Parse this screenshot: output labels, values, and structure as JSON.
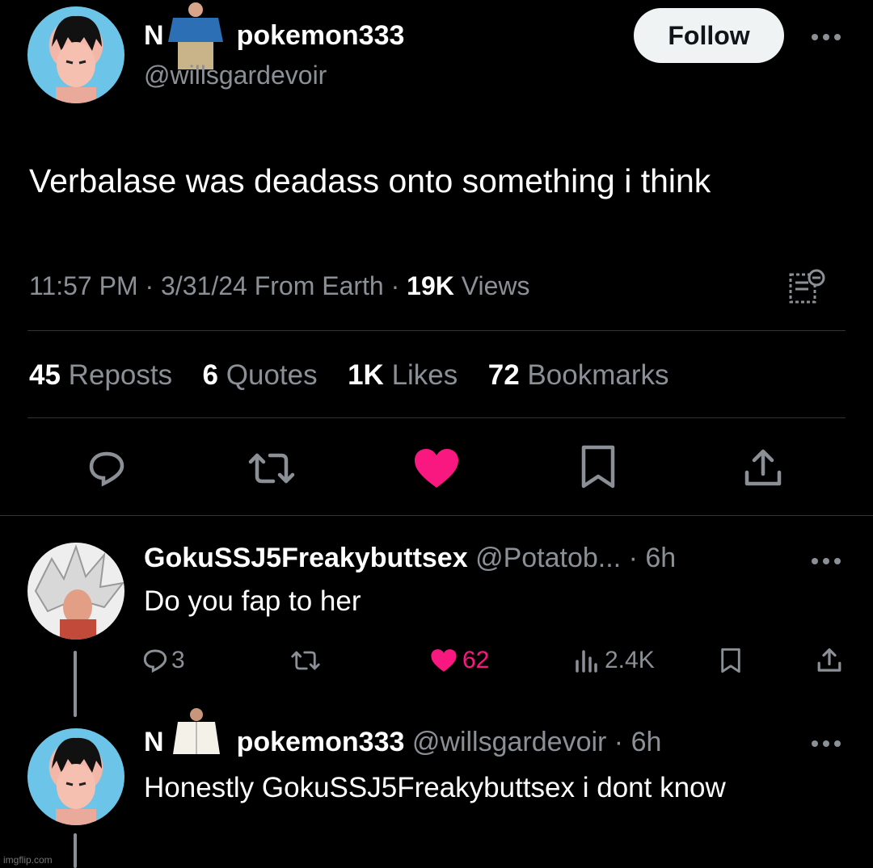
{
  "post": {
    "display_name_prefix": "N",
    "display_name_suffix": "pokemon333",
    "handle": "@willsgardevoir",
    "follow_label": "Follow",
    "text": "Verbalase was deadass onto something i think",
    "time": "11:57 PM",
    "date": "3/31/24",
    "location": "From Earth",
    "views_count": "19K",
    "views_label": "Views",
    "stats": {
      "reposts_count": "45",
      "reposts_label": "Reposts",
      "quotes_count": "6",
      "quotes_label": "Quotes",
      "likes_count": "1K",
      "likes_label": "Likes",
      "bookmarks_count": "72",
      "bookmarks_label": "Bookmarks"
    }
  },
  "replies": [
    {
      "display_name": "GokuSSJ5Freakybuttsex",
      "handle": "@Potatob...",
      "time": "6h",
      "text": "Do you fap to her",
      "reply_count": "3",
      "like_count": "62",
      "view_count": "2.4K"
    },
    {
      "display_name_prefix": "N",
      "display_name_suffix": "pokemon333",
      "handle": "@willsgardevoir",
      "time": "6h",
      "text": "Honestly GokuSSJ5Freakybuttsex i dont know"
    }
  ],
  "watermark": "imgflip.com",
  "colors": {
    "like_pink": "#f91880",
    "background": "#000000",
    "muted": "#8b9097",
    "divider": "#2f3336"
  },
  "icons": [
    "more-icon",
    "reply-icon",
    "repost-icon",
    "heart-icon",
    "bookmark-icon",
    "share-icon",
    "analytics-icon",
    "quote-list-icon"
  ]
}
